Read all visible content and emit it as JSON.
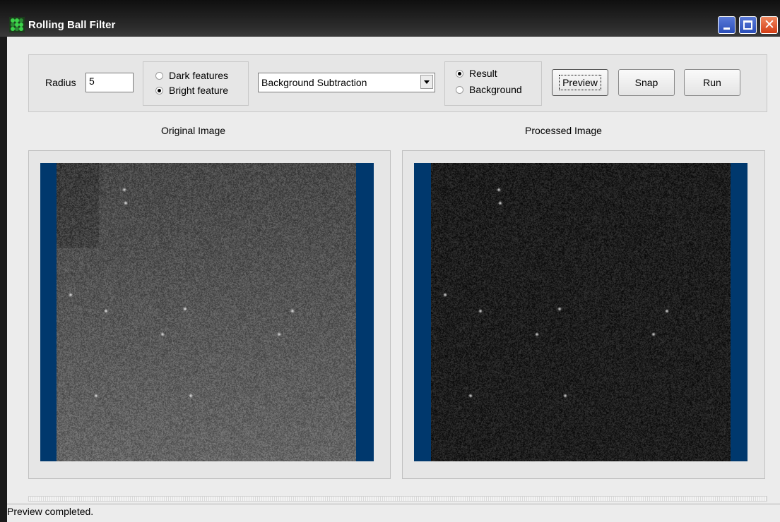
{
  "window": {
    "title": "Rolling Ball Filter",
    "close_glyph": "✕"
  },
  "toolbar": {
    "radius_label": "Radius",
    "radius_value": "5",
    "feature_options": [
      {
        "label": "Dark features",
        "checked": false
      },
      {
        "label": "Bright feature",
        "checked": true
      }
    ],
    "method_selected": "Background Subtraction",
    "output_options": [
      {
        "label": "Result",
        "checked": true
      },
      {
        "label": "Background",
        "checked": false
      }
    ],
    "preview_label": "Preview",
    "snap_label": "Snap",
    "run_label": "Run"
  },
  "panels": {
    "original_title": "Original Image",
    "processed_title": "Processed Image"
  },
  "status": {
    "text": "Preview completed."
  },
  "colors": {
    "image_border_blue": "#00386d",
    "titlebar": "#1a1a1a"
  }
}
